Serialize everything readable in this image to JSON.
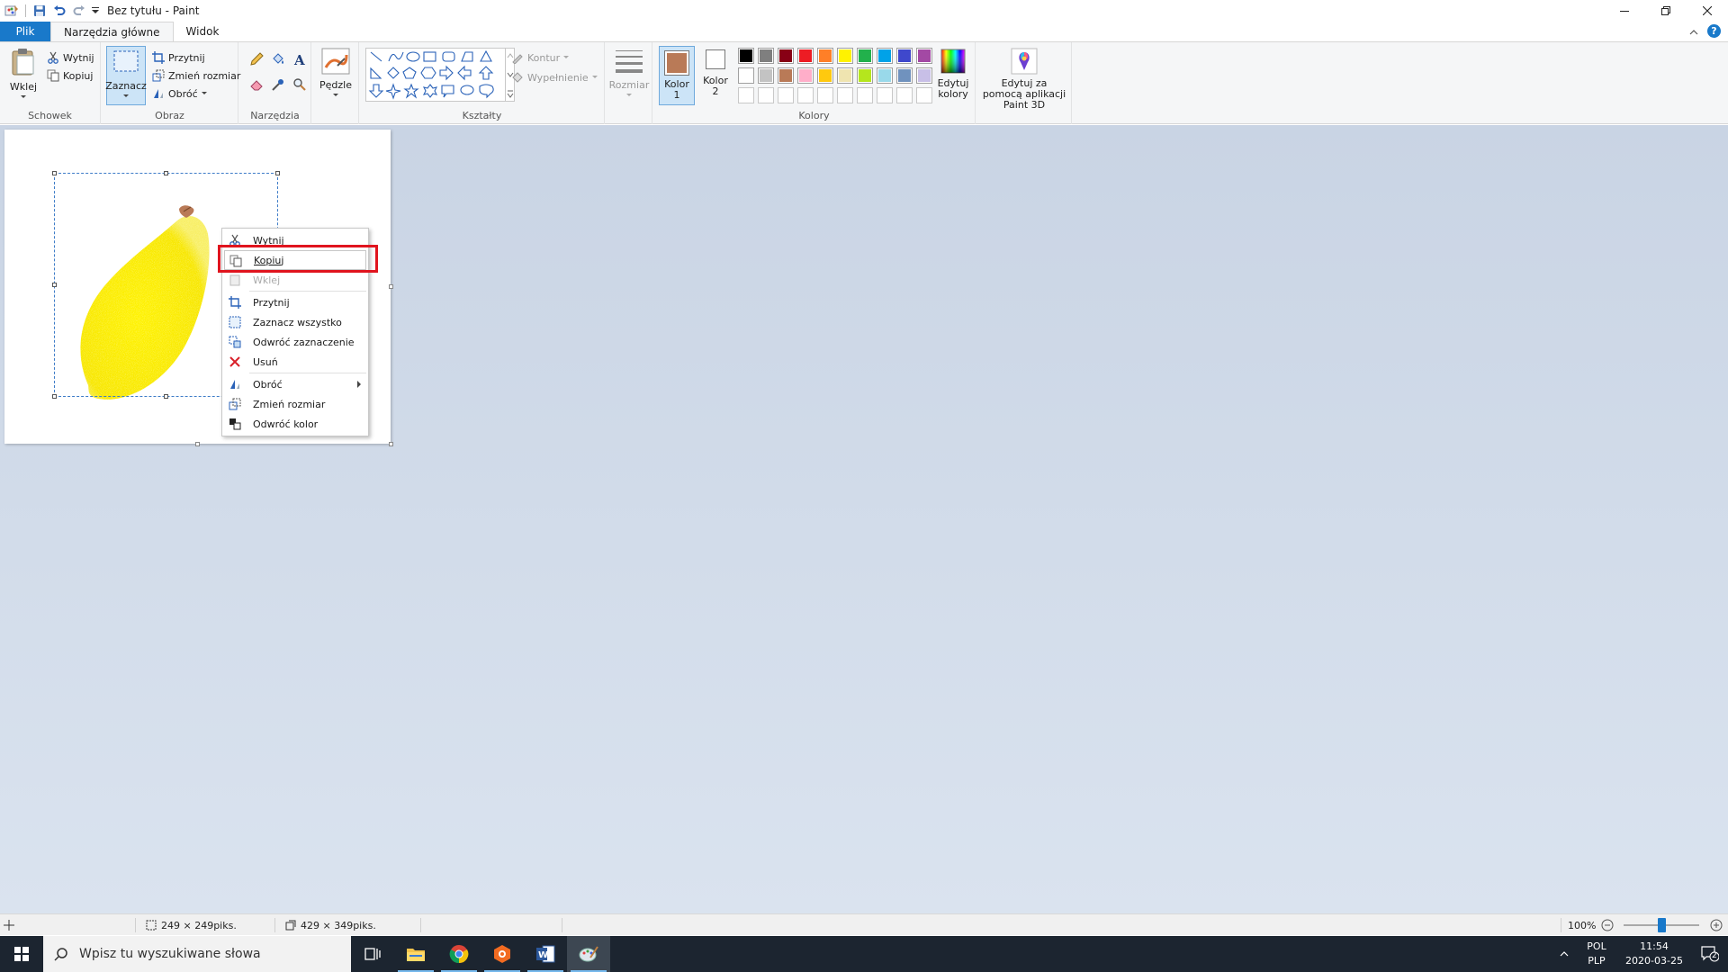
{
  "window": {
    "title": "Bez tytułu - Paint"
  },
  "tabs": {
    "file": "Plik",
    "home": "Narzędzia główne",
    "view": "Widok"
  },
  "clipboard": {
    "paste": "Wklej",
    "cut": "Wytnij",
    "copy": "Kopiuj",
    "label": "Schowek"
  },
  "image": {
    "select": "Zaznacz",
    "crop": "Przytnij",
    "resize": "Zmień rozmiar",
    "rotate": "Obróć",
    "label": "Obraz"
  },
  "tools": {
    "label": "Narzędzia"
  },
  "brushes": {
    "label": "Pędzle"
  },
  "shapes": {
    "outline": "Kontur",
    "fill": "Wypełnienie",
    "label": "Kształty"
  },
  "size": {
    "label": "Rozmiar"
  },
  "colors": {
    "color1": "Kolor 1",
    "color2": "Kolor 2",
    "edit": "Edytuj kolory",
    "label": "Kolory",
    "color1_value": "#b97a57",
    "color2_value": "#ffffff",
    "palette_row1": [
      "#000000",
      "#7f7f7f",
      "#880015",
      "#ed1c24",
      "#ff7f27",
      "#fff200",
      "#22b14c",
      "#00a2e8",
      "#3f48cc",
      "#a349a4"
    ],
    "palette_row2": [
      "#ffffff",
      "#c3c3c3",
      "#b97a57",
      "#ffaec9",
      "#ffc90e",
      "#efe4b0",
      "#b5e61d",
      "#99d9ea",
      "#7092be",
      "#c8bfe7"
    ]
  },
  "paint3d": {
    "label": "Edytuj za pomocą aplikacji Paint 3D"
  },
  "context_menu": {
    "cut": "Wytnij",
    "copy": "Kopiuj",
    "paste": "Wklej",
    "crop": "Przytnij",
    "select_all": "Zaznacz wszystko",
    "invert_selection": "Odwróć zaznaczenie",
    "delete": "Usuń",
    "rotate": "Obróć",
    "resize": "Zmień rozmiar",
    "invert_color": "Odwróć kolor"
  },
  "statusbar": {
    "selection_size": "249 × 249piks.",
    "image_size": "429 × 349piks.",
    "zoom": "100%"
  },
  "taskbar": {
    "search_placeholder": "Wpisz tu wyszukiwane słowa",
    "lang_top": "POL",
    "lang_bottom": "PLP",
    "time": "11:54",
    "date": "2020-03-25",
    "notifications": "2"
  }
}
